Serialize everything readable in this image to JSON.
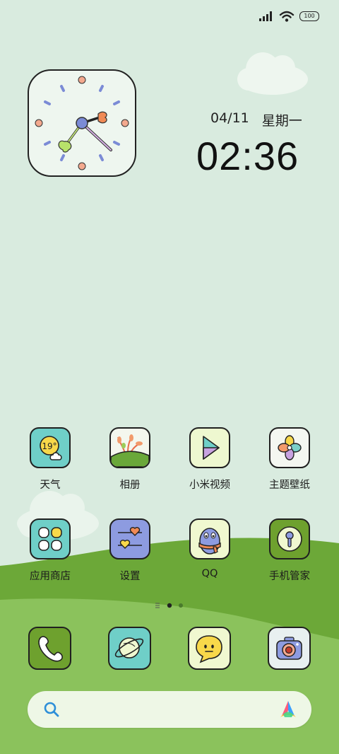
{
  "status_bar": {
    "signal_icon": "signal-bars-icon",
    "wifi_icon": "wifi-icon",
    "battery_level": "100"
  },
  "clock_widget": {
    "date": "04/11",
    "weekday": "星期一",
    "time": "02:36"
  },
  "apps": [
    {
      "label": "天气",
      "icon": "weather-icon",
      "temp": "19°"
    },
    {
      "label": "相册",
      "icon": "gallery-icon"
    },
    {
      "label": "小米视频",
      "icon": "video-play-icon"
    },
    {
      "label": "主题壁纸",
      "icon": "themes-clover-icon"
    },
    {
      "label": "应用商店",
      "icon": "app-store-icon"
    },
    {
      "label": "设置",
      "icon": "settings-sliders-icon"
    },
    {
      "label": "QQ",
      "icon": "qq-penguin-icon"
    },
    {
      "label": "手机管家",
      "icon": "security-lock-icon"
    }
  ],
  "page_indicator": {
    "pages": 2,
    "current": 1
  },
  "dock": [
    {
      "icon": "phone-icon"
    },
    {
      "icon": "browser-planet-icon"
    },
    {
      "icon": "messages-bubble-icon"
    },
    {
      "icon": "camera-icon"
    }
  ],
  "search": {
    "placeholder": "",
    "search_icon": "search-icon",
    "assistant_icon": "app-vault-logo-icon"
  },
  "colors": {
    "background": "#d9ebdf",
    "hill_dark": "#6fa83a",
    "hill_light": "#8cc05a",
    "search_bar": "#eef7e6"
  }
}
